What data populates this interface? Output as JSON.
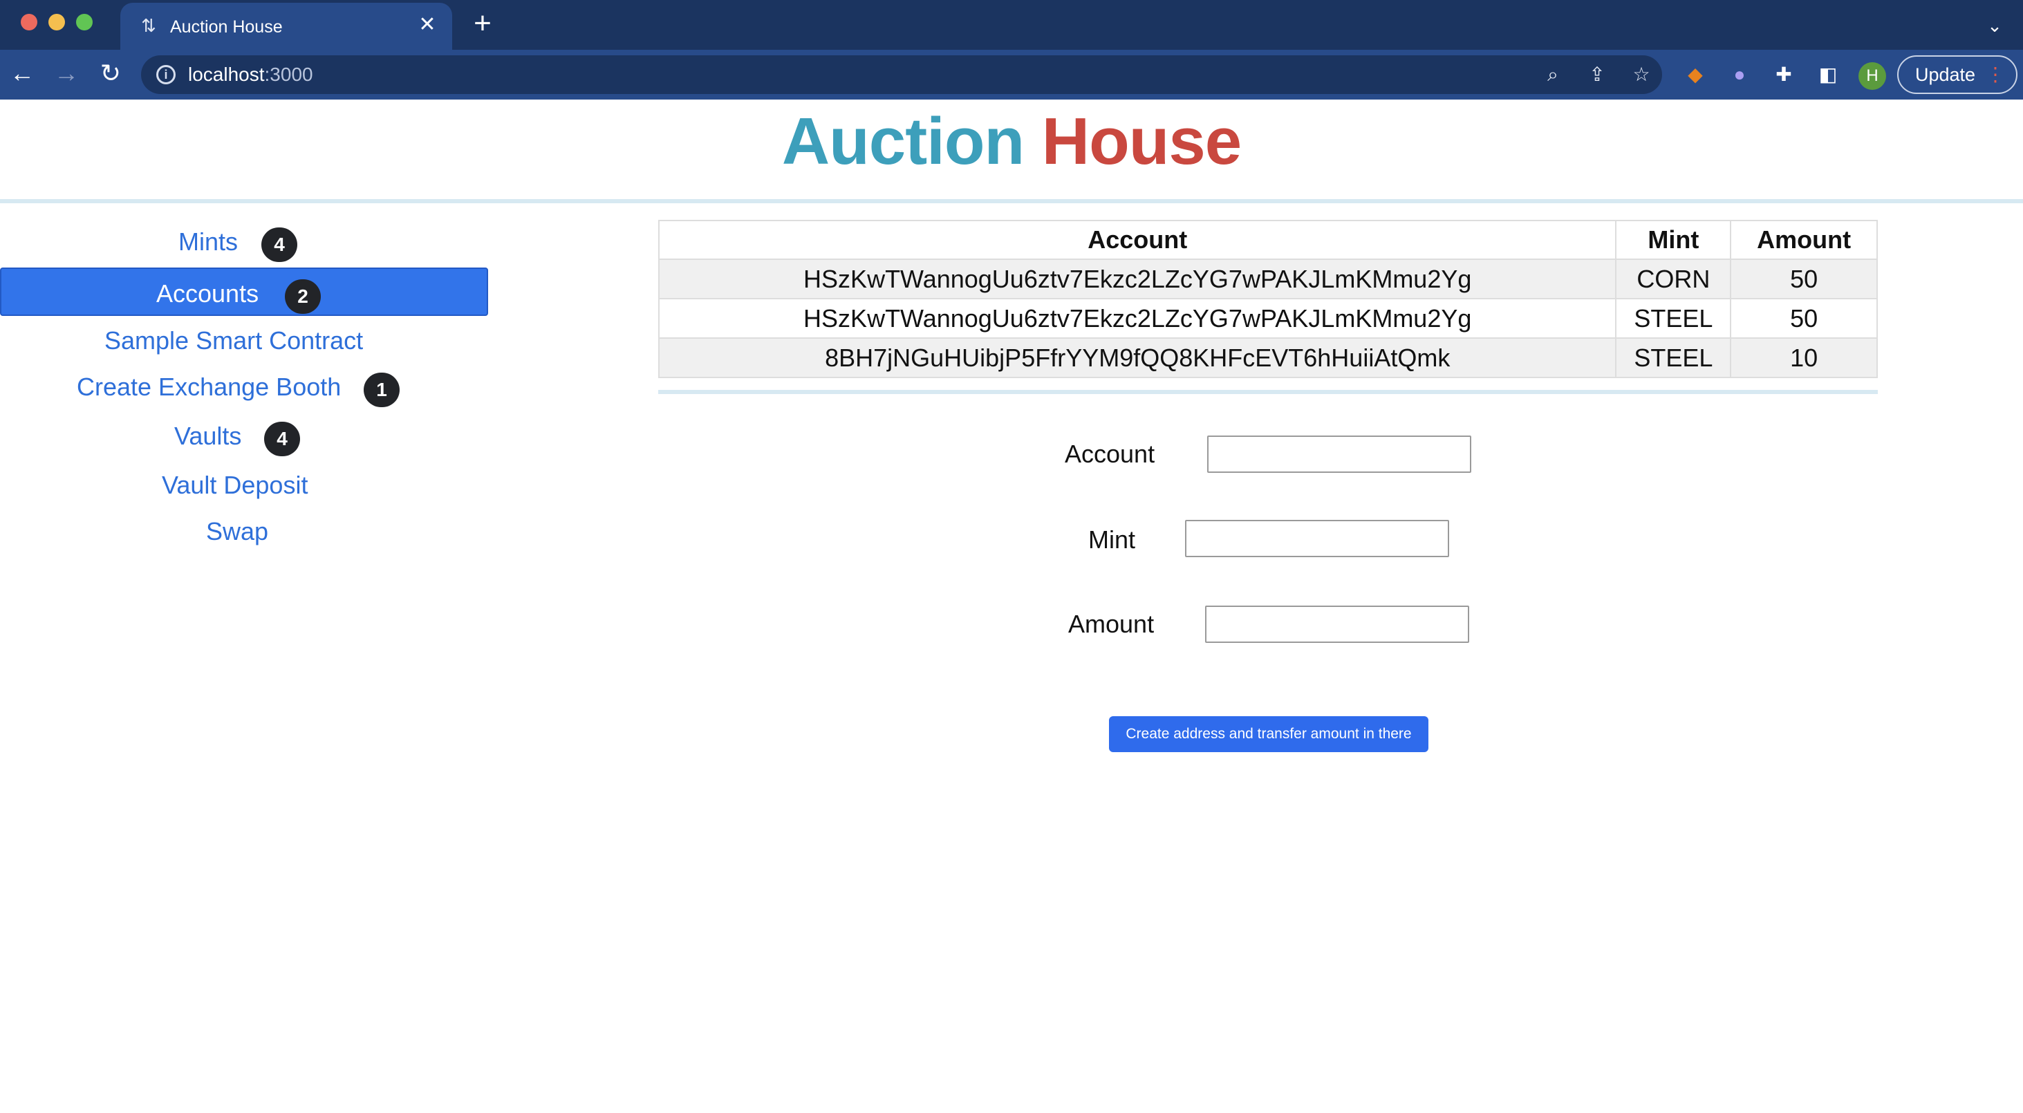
{
  "browser": {
    "tab_title": "Auction House",
    "url_host": "localhost",
    "url_port": ":3000",
    "update_label": "Update",
    "profile_initial": "H"
  },
  "page": {
    "title_word_1": "Auction",
    "title_word_2": "House",
    "title_colors": {
      "word_1": "#3d9fbb",
      "word_2": "#c9483f"
    }
  },
  "sidebar": {
    "active_item": "Accounts",
    "items": [
      {
        "label": "Mints",
        "badge": "4"
      },
      {
        "label": "Accounts",
        "badge": "2"
      },
      {
        "label": "Sample Smart Contract"
      },
      {
        "label": "Create Exchange Booth",
        "badge": "1"
      },
      {
        "label": "Vaults",
        "badge": "4"
      },
      {
        "label": "Vault Deposit"
      },
      {
        "label": "Swap"
      }
    ]
  },
  "accounts_table": {
    "headers": [
      "Account",
      "Mint",
      "Amount"
    ],
    "rows": [
      [
        "HSzKwTWannogUu6ztv7Ekzc2LZcYG7wPAKJLmKMmu2Yg",
        "CORN",
        "50"
      ],
      [
        "HSzKwTWannogUu6ztv7Ekzc2LZcYG7wPAKJLmKMmu2Yg",
        "STEEL",
        "50"
      ],
      [
        "8BH7jNGuHUibjP5FfrYYM9fQQ8KHFcEVT6hHuiiAtQmk",
        "STEEL",
        "10"
      ]
    ]
  },
  "form": {
    "account_label": "Account",
    "account_value": "",
    "mint_label": "Mint",
    "mint_value": "",
    "amount_label": "Amount",
    "amount_value": "",
    "submit_label": "Create address and transfer amount in there"
  },
  "colors": {
    "chrome_dark": "#1b3460",
    "chrome_tab": "#284b8a",
    "accent_blue": "#3274ea",
    "link_blue": "#2e6fd9",
    "badge_dark": "#222428"
  }
}
